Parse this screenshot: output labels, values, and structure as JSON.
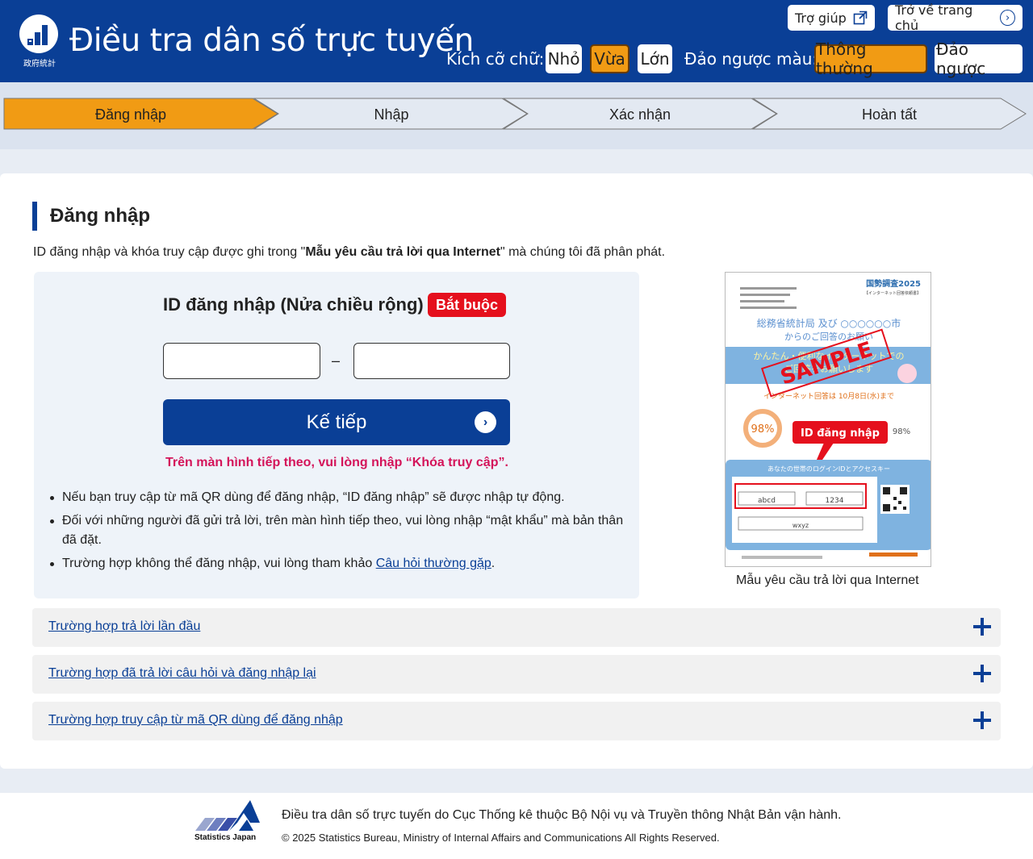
{
  "header": {
    "logo_caption": "政府統計",
    "site_title": "Điều tra dân số trực tuyến",
    "help_label": "Trợ giúp",
    "home_label": "Trở về trang chủ",
    "font_size_label": "Kích cỡ chữ:",
    "font_sizes": [
      "Nhỏ",
      "Vừa",
      "Lớn"
    ],
    "font_size_selected": "Vừa",
    "contrast_label": "Đảo ngược màu:",
    "contrast_options": [
      "Thông thường",
      "Đảo ngược"
    ],
    "contrast_selected": "Thông thường",
    "header_bg": "#0a3f96",
    "selected_color": "#f19b14"
  },
  "steps": {
    "items": [
      "Đăng nhập",
      "Nhập",
      "Xác nhận",
      "Hoàn tất"
    ],
    "current": "Đăng nhập"
  },
  "main": {
    "title": "Đăng nhập",
    "intro_prefix": "ID đăng nhập và khóa truy cập được ghi trong \"",
    "intro_bold": "Mẫu yêu cầu trả lời qua Internet",
    "intro_suffix": "\" mà chúng tôi đã phân phát.",
    "field_label": "ID đăng nhập (Nửa chiều rộng)",
    "required_badge": "Bắt buộc",
    "input_a_value": "",
    "input_b_value": "",
    "separator": "–",
    "next_button": "Kế tiếp",
    "next_note": "Trên màn hình tiếp theo, vui lòng nhập “Khóa truy cập”.",
    "notes": [
      "Nếu bạn truy cập từ mã QR dùng để đăng nhập, “ID đăng nhập” sẽ được nhập tự động.",
      "Đối với những người đã gửi trả lời, trên màn hình tiếp theo, vui lòng nhập “mật khẩu” mà bản thân đã đặt."
    ],
    "note_faq_prefix": "Trường hợp không thể đăng nhập, vui lòng tham khảo ",
    "note_faq_link": "Câu hỏi thường gặp",
    "note_faq_suffix": ".",
    "sample_caption": "Mẫu yêu cầu trả lời qua Internet",
    "sample": {
      "title": "国勢調査2025",
      "subtitle": "【インターネット回答依頼書】",
      "org": "総務省統計局 及び ○○○○○○市",
      "org2": "からのご回答のお願い",
      "banner": "かんたん・便利なインターネットでの",
      "banner2": "ご回答をお願いします",
      "stamp": "SAMPLE",
      "date_label": "インターネット回答は 10月8日(水)まで",
      "pct": "98%",
      "callout": "ID đăng nhập",
      "login_head": "あなたの世帯のログインIDとアクセスキー",
      "id_a": "abcd",
      "id_b": "1234",
      "access": "wxyz"
    },
    "accordions": [
      "Trường hợp trả lời lần đầu",
      "Trường hợp đã trả lời câu hỏi và đăng nhập lại",
      "Trường hợp truy cập từ mã QR dùng để đăng nhập"
    ]
  },
  "footer": {
    "logo_caption": "Statistics Japan",
    "text": "Điều tra dân số trực tuyến do Cục Thống kê thuộc Bộ Nội vụ và Truyền thông Nhật Bản vận hành.",
    "copyright": "© 2025 Statistics Bureau, Ministry of Internal Affairs and Communications All Rights Reserved."
  }
}
